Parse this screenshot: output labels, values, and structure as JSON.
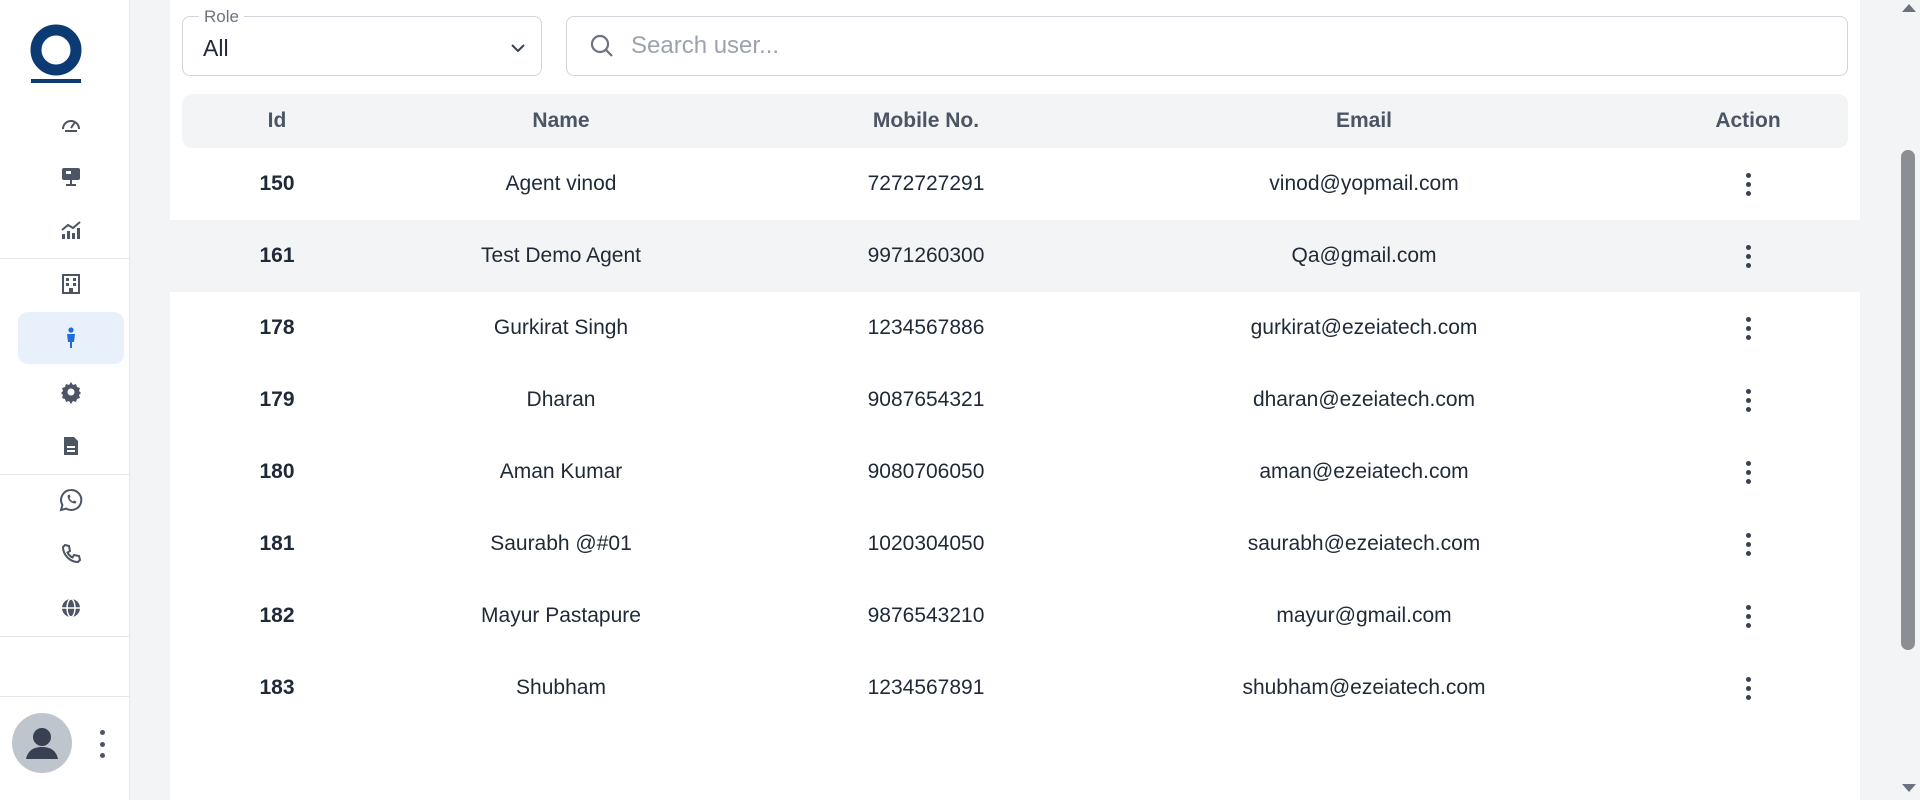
{
  "sidebar": {
    "logo_icon": "brand-logo-icon",
    "items": [
      {
        "icon": "dashboard-gauge-icon",
        "active": false
      },
      {
        "icon": "monitor-icon",
        "active": false
      },
      {
        "icon": "analytics-chart-icon",
        "active": false
      },
      {
        "icon": "building-icon",
        "active": false
      },
      {
        "icon": "agent-user-icon",
        "active": true
      },
      {
        "icon": "gear-icon",
        "active": false
      },
      {
        "icon": "document-icon",
        "active": false
      },
      {
        "icon": "whatsapp-icon",
        "active": false
      },
      {
        "icon": "phone-icon",
        "active": false
      },
      {
        "icon": "globe-icon",
        "active": false
      }
    ],
    "avatar_icon": "user-avatar-icon"
  },
  "filters": {
    "role_label": "Role",
    "role_value": "All",
    "search_placeholder": "Search user..."
  },
  "table": {
    "columns": [
      "Id",
      "Name",
      "Mobile No.",
      "Email",
      "Action"
    ],
    "rows": [
      {
        "id": "150",
        "name": "Agent vinod",
        "mobile": "7272727291",
        "email": "vinod@yopmail.com"
      },
      {
        "id": "161",
        "name": "Test Demo Agent",
        "mobile": "9971260300",
        "email": "Qa@gmail.com"
      },
      {
        "id": "178",
        "name": "Gurkirat Singh",
        "mobile": "1234567886",
        "email": "gurkirat@ezeiatech.com"
      },
      {
        "id": "179",
        "name": "Dharan",
        "mobile": "9087654321",
        "email": "dharan@ezeiatech.com"
      },
      {
        "id": "180",
        "name": "Aman Kumar",
        "mobile": "9080706050",
        "email": "aman@ezeiatech.com"
      },
      {
        "id": "181",
        "name": "Saurabh @#01",
        "mobile": "1020304050",
        "email": "saurabh@ezeiatech.com"
      },
      {
        "id": "182",
        "name": "Mayur Pastapure",
        "mobile": "9876543210",
        "email": "mayur@gmail.com"
      },
      {
        "id": "183",
        "name": "Shubham",
        "mobile": "1234567891",
        "email": "shubham@ezeiatech.com"
      }
    ]
  },
  "colors": {
    "brand": "#0b3b72",
    "accent": "#1e6fd9",
    "active_bg": "#e8f0fb"
  }
}
